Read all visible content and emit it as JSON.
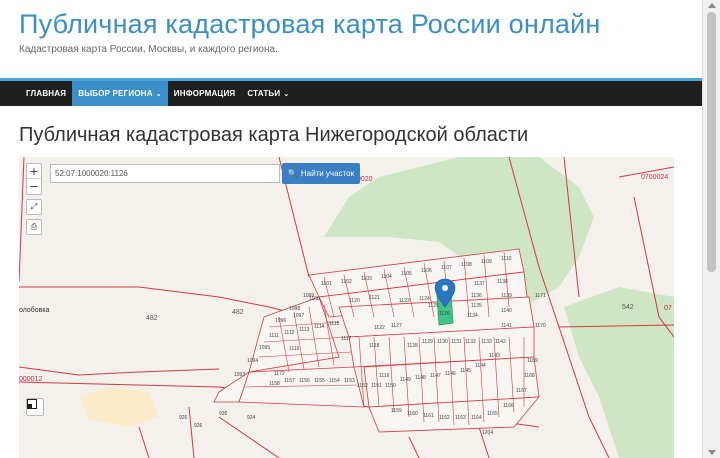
{
  "header": {
    "title": "Публичная кадастровая карта России онлайн",
    "subtitle": "Кадастровая карта России, Москвы, и каждого региона."
  },
  "nav": {
    "items": [
      {
        "label": "ГЛАВНАЯ",
        "active": false
      },
      {
        "label": "ВЫБОР РЕГИОНА",
        "active": true,
        "dropdown": true
      },
      {
        "label": "ИНФОРМАЦИЯ",
        "active": false
      },
      {
        "label": "СТАТЬИ",
        "active": false,
        "dropdown": true
      }
    ]
  },
  "main": {
    "title": "Публичная кадастровая карта Нижегородской области"
  },
  "map": {
    "search_value": "52:07:1000020:1126",
    "find_button": "Найти участок",
    "zoom_in": "+",
    "zoom_out": "−",
    "labels": {
      "top_code": "0020",
      "top_right_code": "0700024",
      "left_place": "олобовка",
      "left_code": "000012",
      "area_482a": "482",
      "area_482b": "482",
      "right_542": "542",
      "right_07": "07"
    },
    "parcels": [
      "1101",
      "1102",
      "1103",
      "1104",
      "1105",
      "1106",
      "1107",
      "1108",
      "1109",
      "1110",
      "1111",
      "1112",
      "1113",
      "1114",
      "1115",
      "1116",
      "1117",
      "1118",
      "1119",
      "1120",
      "1121",
      "1122",
      "1123",
      "1124",
      "1125",
      "1126",
      "1127",
      "1128",
      "1129",
      "1130",
      "1131",
      "1132",
      "1133",
      "1134",
      "1135",
      "1136",
      "1137",
      "1138",
      "1139",
      "1140",
      "1141",
      "1142",
      "1143",
      "1144",
      "1145",
      "1146",
      "1147",
      "1148",
      "1149",
      "1150",
      "1151",
      "1152",
      "1153",
      "1154",
      "1155",
      "1156",
      "1157",
      "1158",
      "1159",
      "1160",
      "1161",
      "1162",
      "1163",
      "1164",
      "1165",
      "1166",
      "1167",
      "1168",
      "1169",
      "1170",
      "1171",
      "1172",
      "1093",
      "1094",
      "1095",
      "1096",
      "1097",
      "1098",
      "1099",
      "1100",
      "926",
      "926",
      "924",
      "926",
      "1204"
    ],
    "colors": {
      "forest": "#cfe6c4",
      "background": "#f4f1ec",
      "boundary": "#d9363e",
      "selected": "#3fc48a",
      "marker": "#2c74c4"
    }
  },
  "icons": {
    "search": "search-icon",
    "fullscreen": "fullscreen-icon",
    "print": "print-icon",
    "layers": "layers-icon",
    "marker": "map-marker-icon"
  }
}
